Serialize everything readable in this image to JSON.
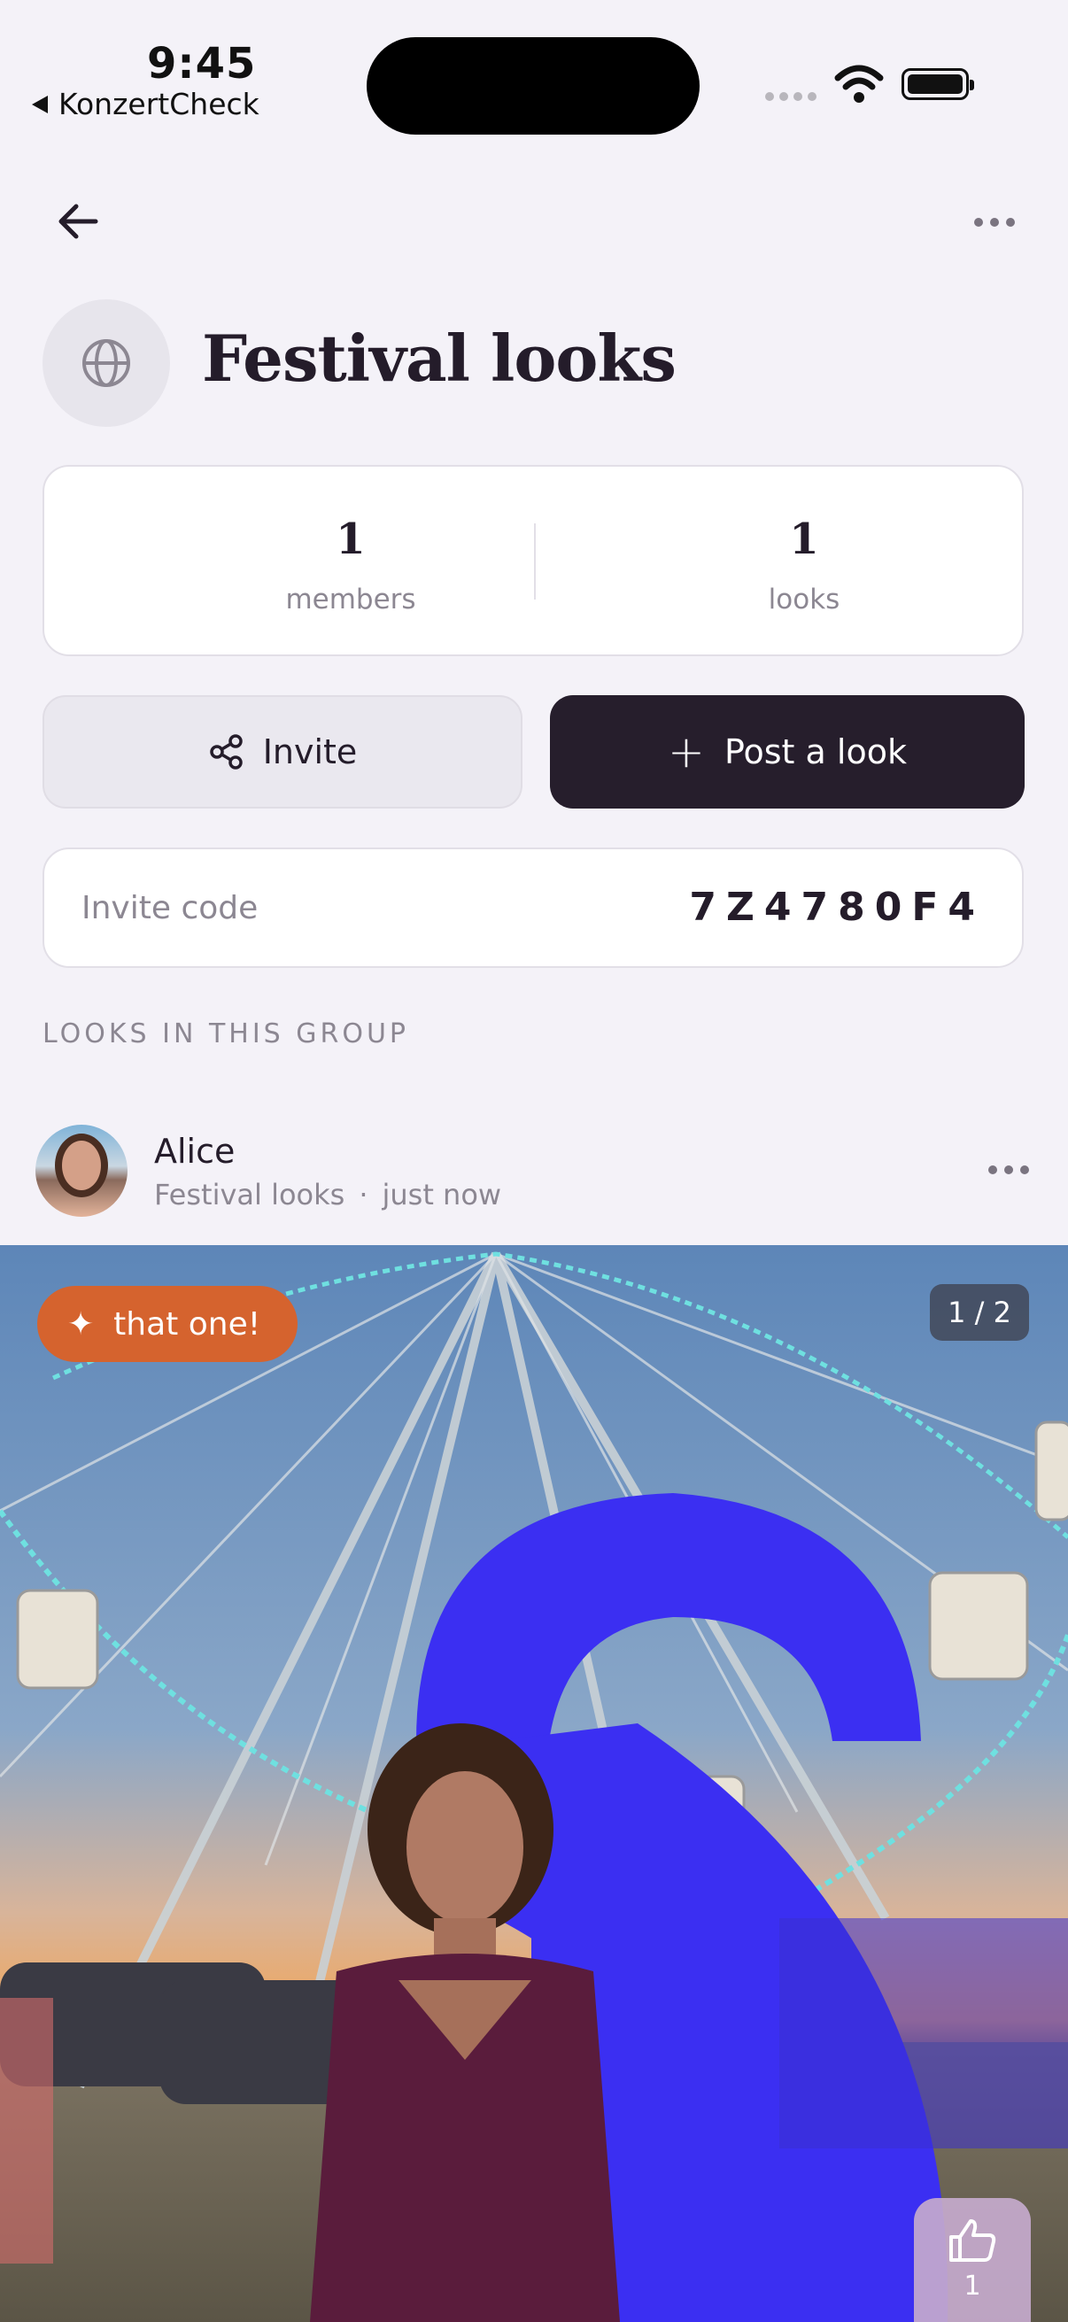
{
  "status_bar": {
    "time": "9:45",
    "back_app": "KonzertCheck"
  },
  "group": {
    "title": "Festival looks"
  },
  "stats": {
    "members_count": "1",
    "members_label": "members",
    "looks_count": "1",
    "looks_label": "looks"
  },
  "actions": {
    "invite_label": "Invite",
    "post_label": "Post a look"
  },
  "invite_code": {
    "label": "Invite code",
    "value": "7Z4780F4"
  },
  "section_heading": "LOOKS IN THIS GROUP",
  "post": {
    "author": "Alice",
    "group": "Festival looks",
    "separator": "·",
    "time": "just now",
    "badge": "that one!",
    "image_counter": "1 / 2",
    "likes": "1"
  },
  "colors": {
    "accent_orange": "#d5632e",
    "primary_dark": "#261e2c",
    "like_bg": "#c6aacd"
  },
  "icons": [
    "back-arrow-icon",
    "more-icon",
    "globe-icon",
    "share-icon",
    "plus-icon",
    "sparkle-icon",
    "thumbs-up-icon"
  ]
}
